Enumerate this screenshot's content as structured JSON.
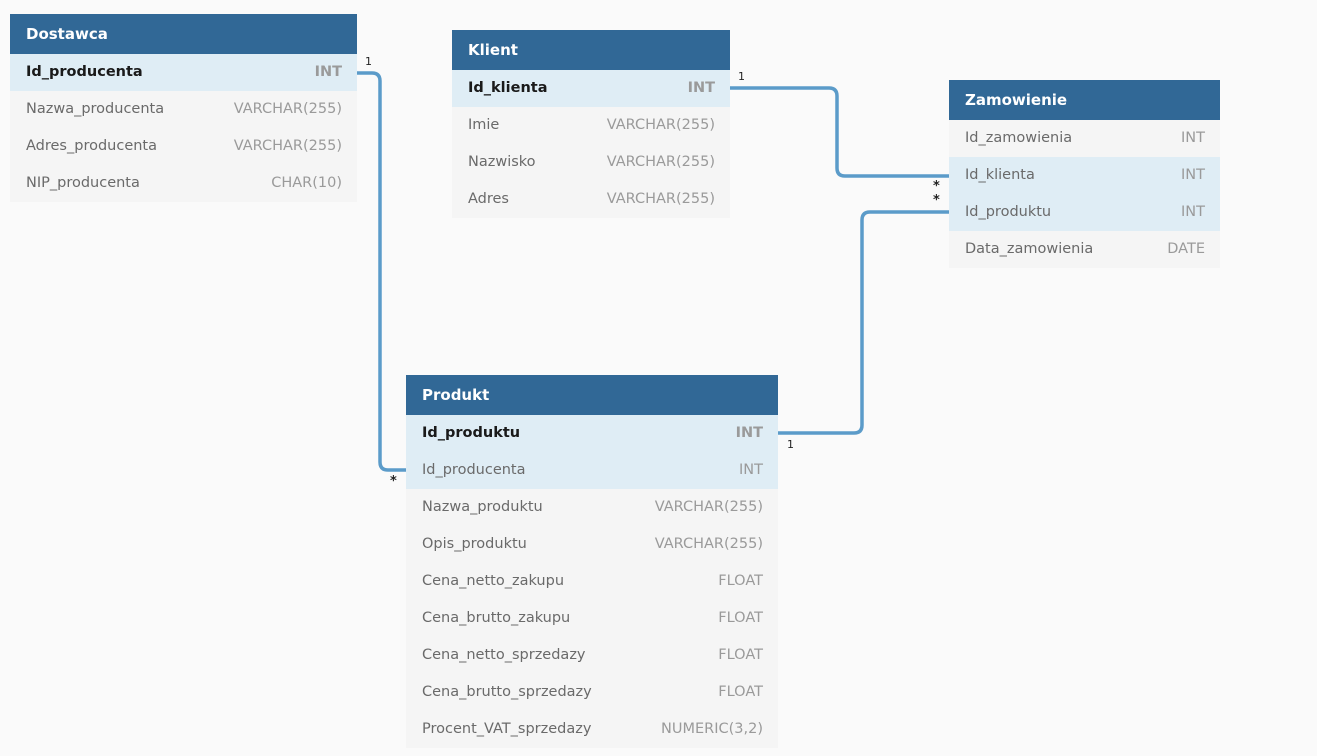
{
  "tables": {
    "dostawca": {
      "name": "Dostawca",
      "columns": [
        {
          "name": "Id_producenta",
          "type": "INT",
          "pk": true,
          "highlight": true
        },
        {
          "name": "Nazwa_producenta",
          "type": "VARCHAR(255)",
          "pk": false,
          "highlight": false
        },
        {
          "name": "Adres_producenta",
          "type": "VARCHAR(255)",
          "pk": false,
          "highlight": false
        },
        {
          "name": "NIP_producenta",
          "type": "CHAR(10)",
          "pk": false,
          "highlight": false
        }
      ]
    },
    "klient": {
      "name": "Klient",
      "columns": [
        {
          "name": "Id_klienta",
          "type": "INT",
          "pk": true,
          "highlight": true
        },
        {
          "name": "Imie",
          "type": "VARCHAR(255)",
          "pk": false,
          "highlight": false
        },
        {
          "name": "Nazwisko",
          "type": "VARCHAR(255)",
          "pk": false,
          "highlight": false
        },
        {
          "name": "Adres",
          "type": "VARCHAR(255)",
          "pk": false,
          "highlight": false
        }
      ]
    },
    "zamowienie": {
      "name": "Zamowienie",
      "columns": [
        {
          "name": "Id_zamowienia",
          "type": "INT",
          "pk": false,
          "highlight": false
        },
        {
          "name": "Id_klienta",
          "type": "INT",
          "pk": false,
          "highlight": true
        },
        {
          "name": "Id_produktu",
          "type": "INT",
          "pk": false,
          "highlight": true
        },
        {
          "name": "Data_zamowienia",
          "type": "DATE",
          "pk": false,
          "highlight": false
        }
      ]
    },
    "produkt": {
      "name": "Produkt",
      "columns": [
        {
          "name": "Id_produktu",
          "type": "INT",
          "pk": true,
          "highlight": true
        },
        {
          "name": "Id_producenta",
          "type": "INT",
          "pk": false,
          "highlight": true
        },
        {
          "name": "Nazwa_produktu",
          "type": "VARCHAR(255)",
          "pk": false,
          "highlight": false
        },
        {
          "name": "Opis_produktu",
          "type": "VARCHAR(255)",
          "pk": false,
          "highlight": false
        },
        {
          "name": "Cena_netto_zakupu",
          "type": "FLOAT",
          "pk": false,
          "highlight": false
        },
        {
          "name": "Cena_brutto_zakupu",
          "type": "FLOAT",
          "pk": false,
          "highlight": false
        },
        {
          "name": "Cena_netto_sprzedazy",
          "type": "FLOAT",
          "pk": false,
          "highlight": false
        },
        {
          "name": "Cena_brutto_sprzedazy",
          "type": "FLOAT",
          "pk": false,
          "highlight": false
        },
        {
          "name": "Procent_VAT_sprzedazy",
          "type": "NUMERIC(3,2)",
          "pk": false,
          "highlight": false
        }
      ]
    }
  },
  "relations": [
    {
      "from": "Dostawca.Id_producenta",
      "to": "Produkt.Id_producenta",
      "from_card": "1",
      "to_card": "*"
    },
    {
      "from": "Klient.Id_klienta",
      "to": "Zamowienie.Id_klienta",
      "from_card": "1",
      "to_card": "*"
    },
    {
      "from": "Produkt.Id_produktu",
      "to": "Zamowienie.Id_produktu",
      "from_card": "1",
      "to_card": "*"
    }
  ],
  "colors": {
    "header": "#316896",
    "link": "#5b9bc9",
    "highlight_row": "#dfedf5",
    "table_bg": "#f5f5f5",
    "canvas_bg": "#fafafa"
  }
}
